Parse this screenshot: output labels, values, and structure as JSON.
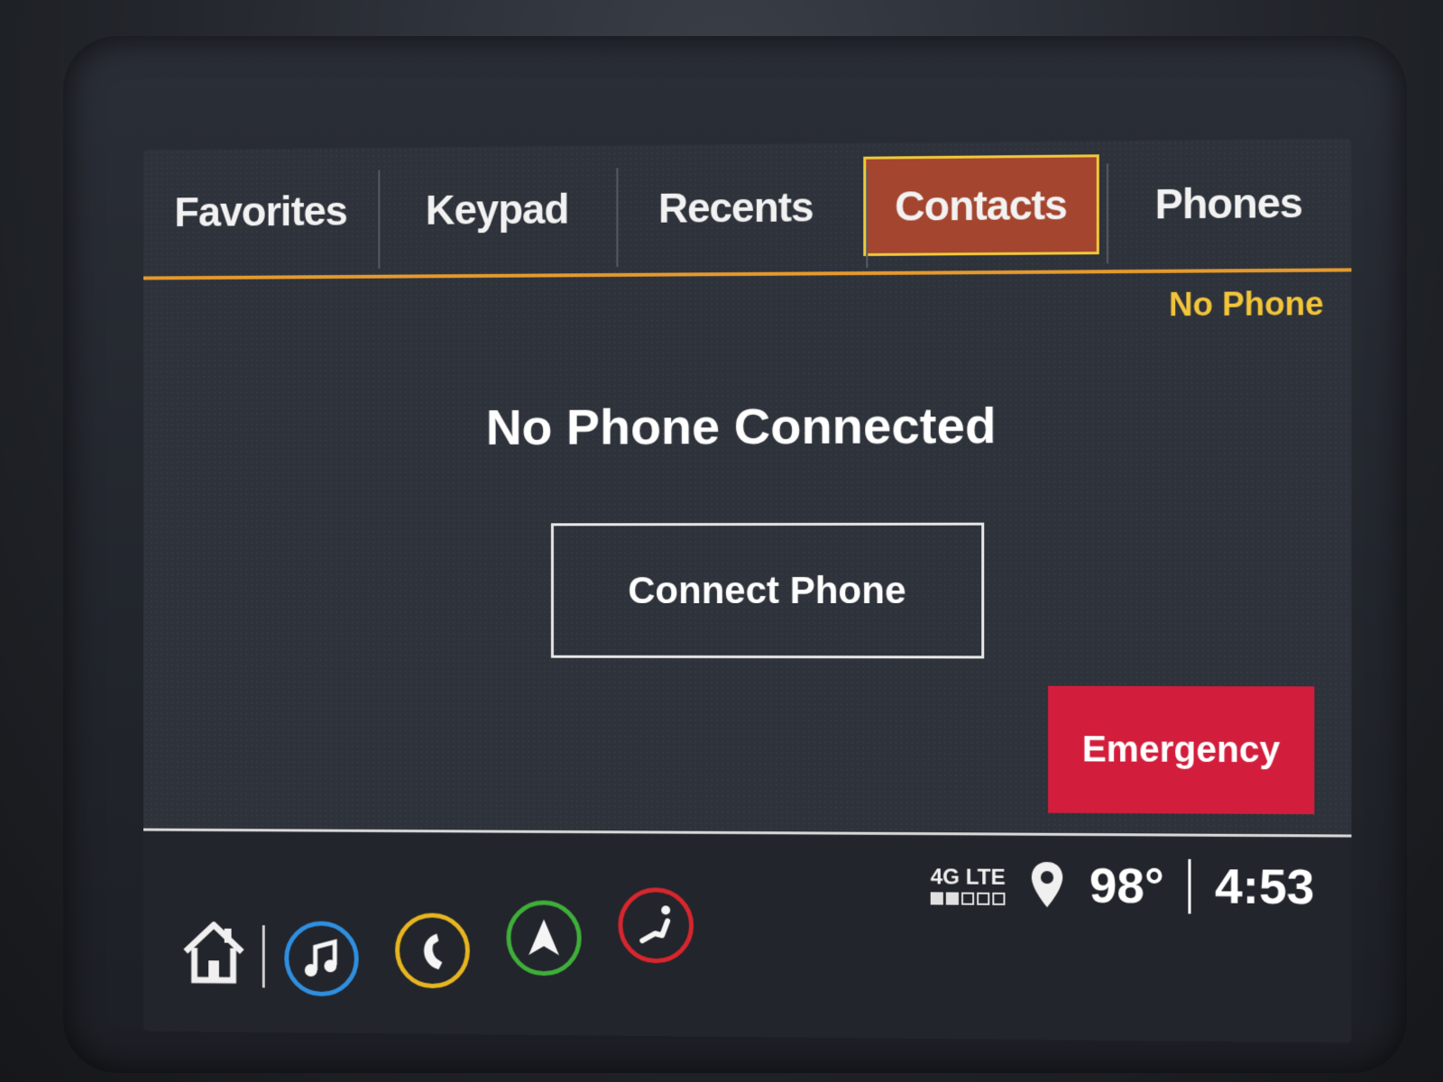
{
  "tabs": [
    {
      "label": "Favorites",
      "active": false
    },
    {
      "label": "Keypad",
      "active": false
    },
    {
      "label": "Recents",
      "active": false
    },
    {
      "label": "Contacts",
      "active": true
    },
    {
      "label": "Phones",
      "active": false
    }
  ],
  "phone_status": "No Phone",
  "message": "No Phone Connected",
  "connect_button": "Connect Phone",
  "emergency_button": "Emergency",
  "status_bar": {
    "network": "4G LTE",
    "signal_strength": 0.4,
    "temperature": "98°",
    "time": "4:53"
  },
  "bottom_nav": [
    {
      "name": "home-icon"
    },
    {
      "name": "audio-icon",
      "color": "#2f8fe0"
    },
    {
      "name": "phone-icon",
      "color": "#e6b520"
    },
    {
      "name": "navigation-icon",
      "color": "#3fae3a"
    },
    {
      "name": "seat-icon",
      "color": "#d8262e"
    }
  ],
  "colors": {
    "active_tab": "#a4452f",
    "active_tab_border": "#f0c93a",
    "accent_rule": "#e59a2e",
    "phone_status": "#f2c53a",
    "emergency": "#d21e3c"
  }
}
